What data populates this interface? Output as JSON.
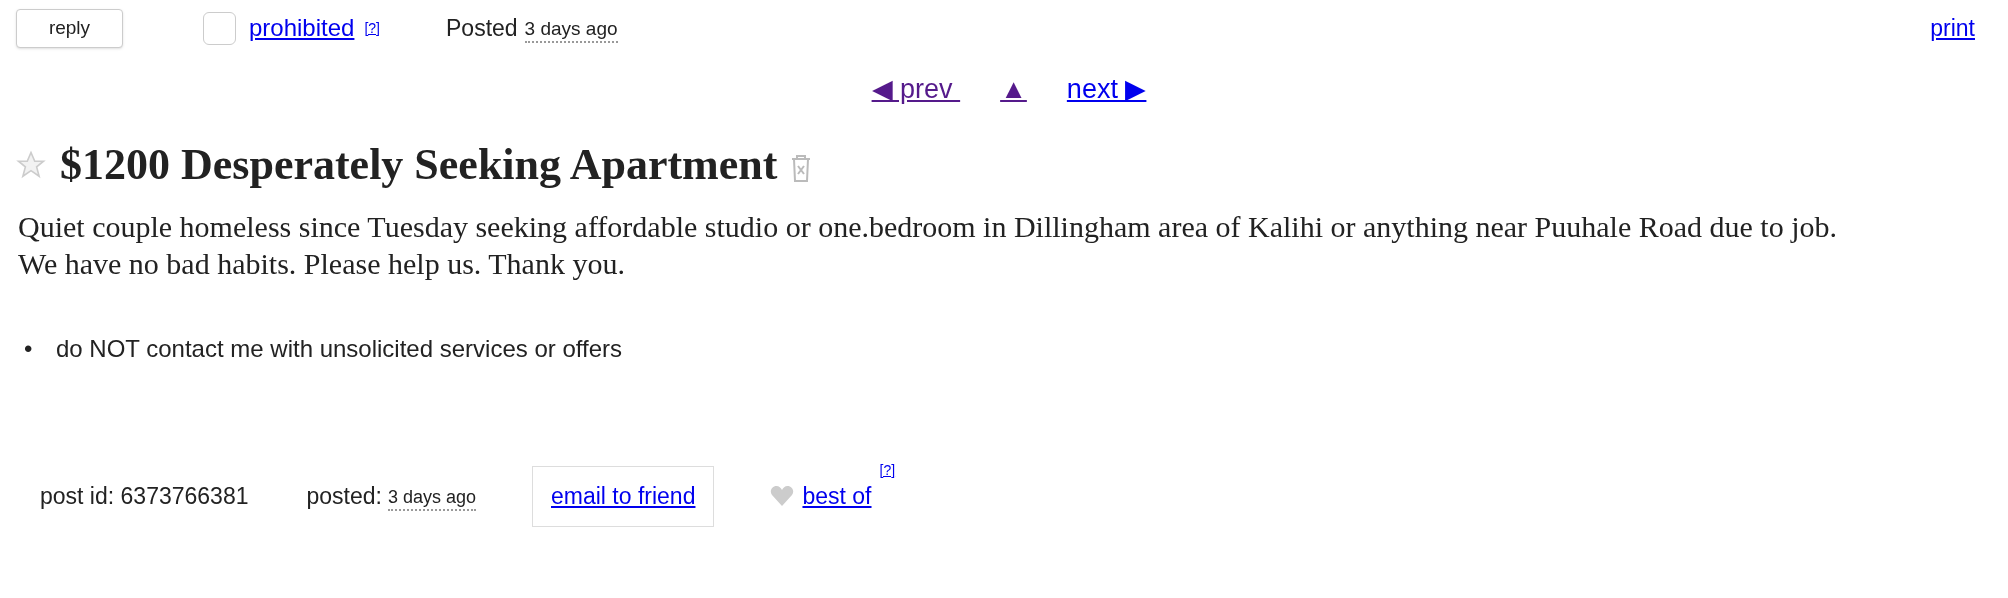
{
  "top_bar": {
    "reply_button": "reply",
    "flag": {
      "checked": false,
      "label": "prohibited",
      "help": "[?]"
    },
    "posted_label": "Posted",
    "posted_time": "3 days ago",
    "print": "print"
  },
  "nav": [
    {
      "kind": "prev",
      "arrow": "◀",
      "label": "prev",
      "visited": true
    },
    {
      "kind": "up",
      "arrow": "▲",
      "visited": true
    },
    {
      "kind": "next",
      "arrow": "▶",
      "label": "next",
      "visited": false
    }
  ],
  "title": {
    "starred": false,
    "text": "$1200 Desperately Seeking Apartment"
  },
  "body": [
    "Quiet couple homeless since Tuesday seeking affordable studio or one.bedroom in Dillingham area of Kalihi or anything near Puuhale Road due to job.",
    "We have no bad habits. Please help us. Thank you."
  ],
  "notices": [
    {
      "bullet": "•",
      "text": "do NOT contact me with unsolicited services or offers"
    }
  ],
  "footer": {
    "post_id": "post id: 6373766381",
    "posted_label": "posted:",
    "posted_time": "3 days ago",
    "email": "email to friend",
    "best_of": "best of",
    "help": "[?]"
  }
}
